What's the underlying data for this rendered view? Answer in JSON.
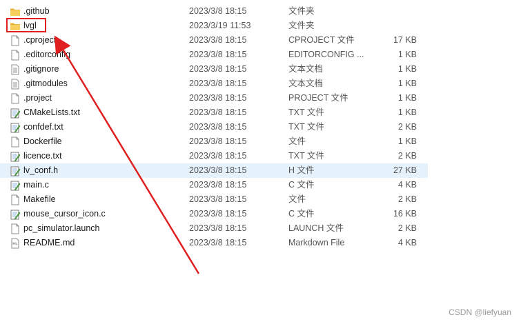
{
  "files": [
    {
      "name": ".github",
      "date": "2023/3/8 18:15",
      "type": "文件夹",
      "size": "",
      "icon": "folder-icon"
    },
    {
      "name": "lvgl",
      "date": "2023/3/19 11:53",
      "type": "文件夹",
      "size": "",
      "icon": "folder-icon"
    },
    {
      "name": ".cproject",
      "date": "2023/3/8 18:15",
      "type": "CPROJECT 文件",
      "size": "17 KB",
      "icon": "blank-file-icon"
    },
    {
      "name": ".editorconfig",
      "date": "2023/3/8 18:15",
      "type": "EDITORCONFIG ...",
      "size": "1 KB",
      "icon": "blank-file-icon"
    },
    {
      "name": ".gitignore",
      "date": "2023/3/8 18:15",
      "type": "文本文档",
      "size": "1 KB",
      "icon": "text-doc-icon"
    },
    {
      "name": ".gitmodules",
      "date": "2023/3/8 18:15",
      "type": "文本文档",
      "size": "1 KB",
      "icon": "text-doc-icon"
    },
    {
      "name": ".project",
      "date": "2023/3/8 18:15",
      "type": "PROJECT 文件",
      "size": "1 KB",
      "icon": "blank-file-icon"
    },
    {
      "name": "CMakeLists.txt",
      "date": "2023/3/8 18:15",
      "type": "TXT 文件",
      "size": "1 KB",
      "icon": "notepad-file-icon"
    },
    {
      "name": "confdef.txt",
      "date": "2023/3/8 18:15",
      "type": "TXT 文件",
      "size": "2 KB",
      "icon": "notepad-file-icon"
    },
    {
      "name": "Dockerfile",
      "date": "2023/3/8 18:15",
      "type": "文件",
      "size": "1 KB",
      "icon": "blank-file-icon"
    },
    {
      "name": "licence.txt",
      "date": "2023/3/8 18:15",
      "type": "TXT 文件",
      "size": "2 KB",
      "icon": "notepad-file-icon"
    },
    {
      "name": "lv_conf.h",
      "date": "2023/3/8 18:15",
      "type": "H 文件",
      "size": "27 KB",
      "icon": "notepad-file-icon"
    },
    {
      "name": "main.c",
      "date": "2023/3/8 18:15",
      "type": "C 文件",
      "size": "4 KB",
      "icon": "notepad-file-icon"
    },
    {
      "name": "Makefile",
      "date": "2023/3/8 18:15",
      "type": "文件",
      "size": "2 KB",
      "icon": "blank-file-icon"
    },
    {
      "name": "mouse_cursor_icon.c",
      "date": "2023/3/8 18:15",
      "type": "C 文件",
      "size": "16 KB",
      "icon": "notepad-file-icon"
    },
    {
      "name": "pc_simulator.launch",
      "date": "2023/3/8 18:15",
      "type": "LAUNCH 文件",
      "size": "2 KB",
      "icon": "blank-file-icon"
    },
    {
      "name": "README.md",
      "date": "2023/3/8 18:15",
      "type": "Markdown File",
      "size": "4 KB",
      "icon": "markdown-file-icon"
    }
  ],
  "hovered_row": "lv_conf.h",
  "annotation": {
    "highlighted_item": "lvgl",
    "color": "#e02020"
  },
  "watermark": "CSDN @liefyuan",
  "colors": {
    "hover": "#e5f1fb",
    "folder": "#f4c542",
    "accent_red": "#e02020"
  }
}
